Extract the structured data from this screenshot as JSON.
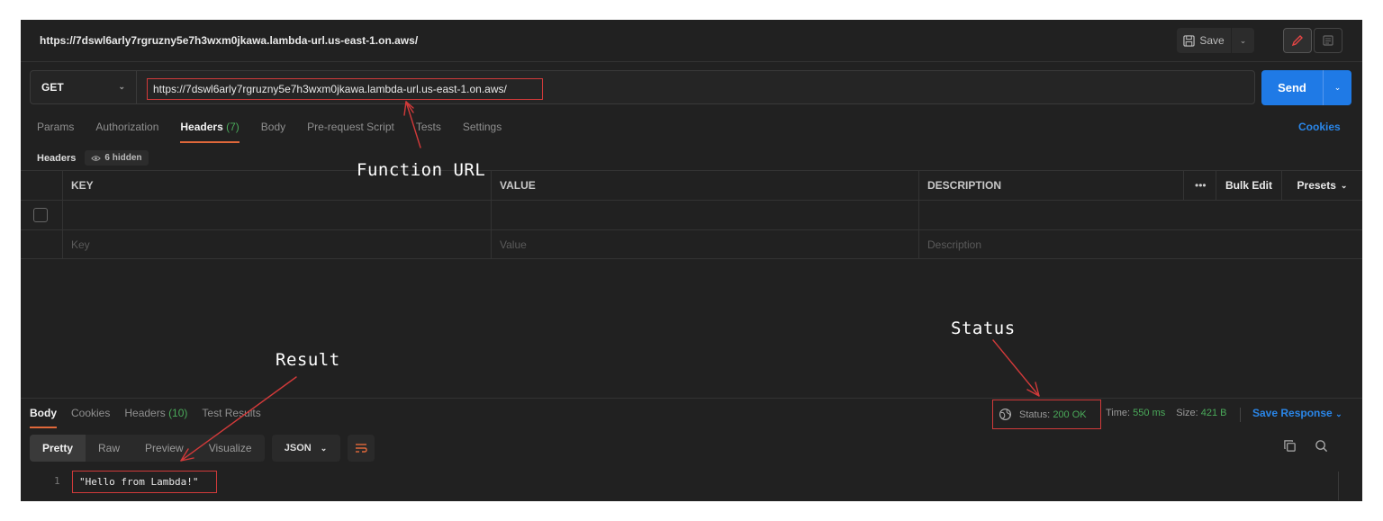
{
  "titlebar": {
    "url": "https://7dswl6arly7rgruzny5e7h3wxm0jkawa.lambda-url.us-east-1.on.aws/",
    "save_label": "Save"
  },
  "request": {
    "method": "GET",
    "url": "https://7dswl6arly7rgruzny5e7h3wxm0jkawa.lambda-url.us-east-1.on.aws/",
    "send_label": "Send"
  },
  "tabs": [
    {
      "label": "Params"
    },
    {
      "label": "Authorization"
    },
    {
      "label": "Headers",
      "count": "(7)"
    },
    {
      "label": "Body"
    },
    {
      "label": "Pre-request Script"
    },
    {
      "label": "Tests"
    },
    {
      "label": "Settings"
    }
  ],
  "cookies_label": "Cookies",
  "headers_section": {
    "label": "Headers",
    "hidden_label": "6 hidden"
  },
  "table": {
    "columns": {
      "key": "KEY",
      "value": "VALUE",
      "description": "DESCRIPTION",
      "more": "•••",
      "bulk_edit": "Bulk Edit",
      "presets": "Presets"
    },
    "placeholders": {
      "key": "Key",
      "value": "Value",
      "description": "Description"
    }
  },
  "response": {
    "tabs": [
      {
        "label": "Body"
      },
      {
        "label": "Cookies"
      },
      {
        "label": "Headers",
        "count": "(10)"
      },
      {
        "label": "Test Results"
      }
    ],
    "status_label": "Status:",
    "status_value": "200 OK",
    "time_label": "Time:",
    "time_value": "550 ms",
    "size_label": "Size:",
    "size_value": "421 B",
    "save_response_label": "Save Response",
    "views": [
      {
        "label": "Pretty"
      },
      {
        "label": "Raw"
      },
      {
        "label": "Preview"
      },
      {
        "label": "Visualize"
      }
    ],
    "format": "JSON",
    "line_number": "1",
    "body": "\"Hello from Lambda!\""
  },
  "annotations": {
    "function_url": "Function URL",
    "status": "Status",
    "result": "Result"
  },
  "colors": {
    "background": "#212121",
    "accent_orange": "#e0683a",
    "send_blue": "#1f7ae6",
    "link_blue": "#2a86e8",
    "ok_green": "#4aaa5a",
    "highlight_red": "#d23a3a"
  }
}
